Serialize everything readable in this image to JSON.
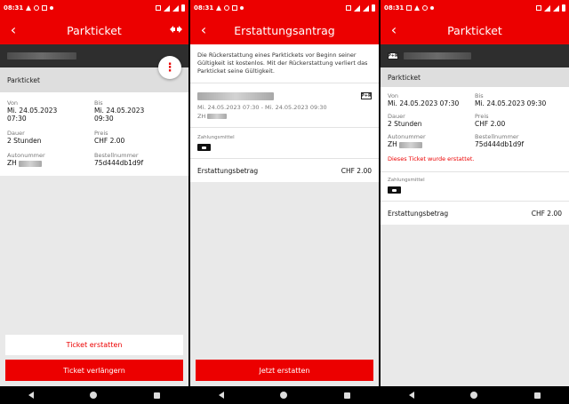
{
  "status": {
    "time": "08:31"
  },
  "screen1": {
    "title": "Parkticket",
    "section_title": "Parkticket",
    "von_label": "Von",
    "von_value": "Mi. 24.05.2023 07:30",
    "bis_label": "Bis",
    "bis_value": "Mi. 24.05.2023 09:30",
    "dauer_label": "Dauer",
    "dauer_value": "2 Stunden",
    "preis_label": "Preis",
    "preis_value": "CHF 2.00",
    "autonummer_label": "Autonummer",
    "autonummer_value": "ZH",
    "bestellnummer_label": "Bestellnummer",
    "bestellnummer_value": "75d444db1d9f",
    "refund_button": "Ticket erstatten",
    "extend_button": "Ticket verlängern"
  },
  "screen2": {
    "title": "Erstattungsantrag",
    "note": "Die Rückerstattung eines Parktickets vor Beginn seiner Gültigkeit ist kostenlos. Mit der Rückerstattung verliert das Parkticket seine Gültigkeit.",
    "period": "Mi. 24.05.2023 07:30 - Mi. 24.05.2023 09:30",
    "plate": "ZH",
    "pr_badge": "P+R",
    "payment_label": "Zahlungsmittel",
    "amount_label": "Erstattungsbetrag",
    "amount_value": "CHF 2.00",
    "submit_button": "Jetzt erstatten"
  },
  "screen3": {
    "title": "Parkticket",
    "pr_badge": "P+R",
    "section_title": "Parkticket",
    "von_label": "Von",
    "von_value": "Mi. 24.05.2023 07:30",
    "bis_label": "Bis",
    "bis_value": "Mi. 24.05.2023 09:30",
    "dauer_label": "Dauer",
    "dauer_value": "2 Stunden",
    "preis_label": "Preis",
    "preis_value": "CHF 2.00",
    "autonummer_label": "Autonummer",
    "autonummer_value": "ZH",
    "bestellnummer_label": "Bestellnummer",
    "bestellnummer_value": "75d444db1d9f",
    "refunded_msg": "Dieses Ticket wurde erstattet.",
    "payment_label": "Zahlungsmittel",
    "amount_label": "Erstattungsbetrag",
    "amount_value": "CHF 2.00"
  },
  "colors": {
    "brand_red": "#ec0000",
    "dark_band": "#2e2e2e",
    "background": "#e9e9e9"
  }
}
